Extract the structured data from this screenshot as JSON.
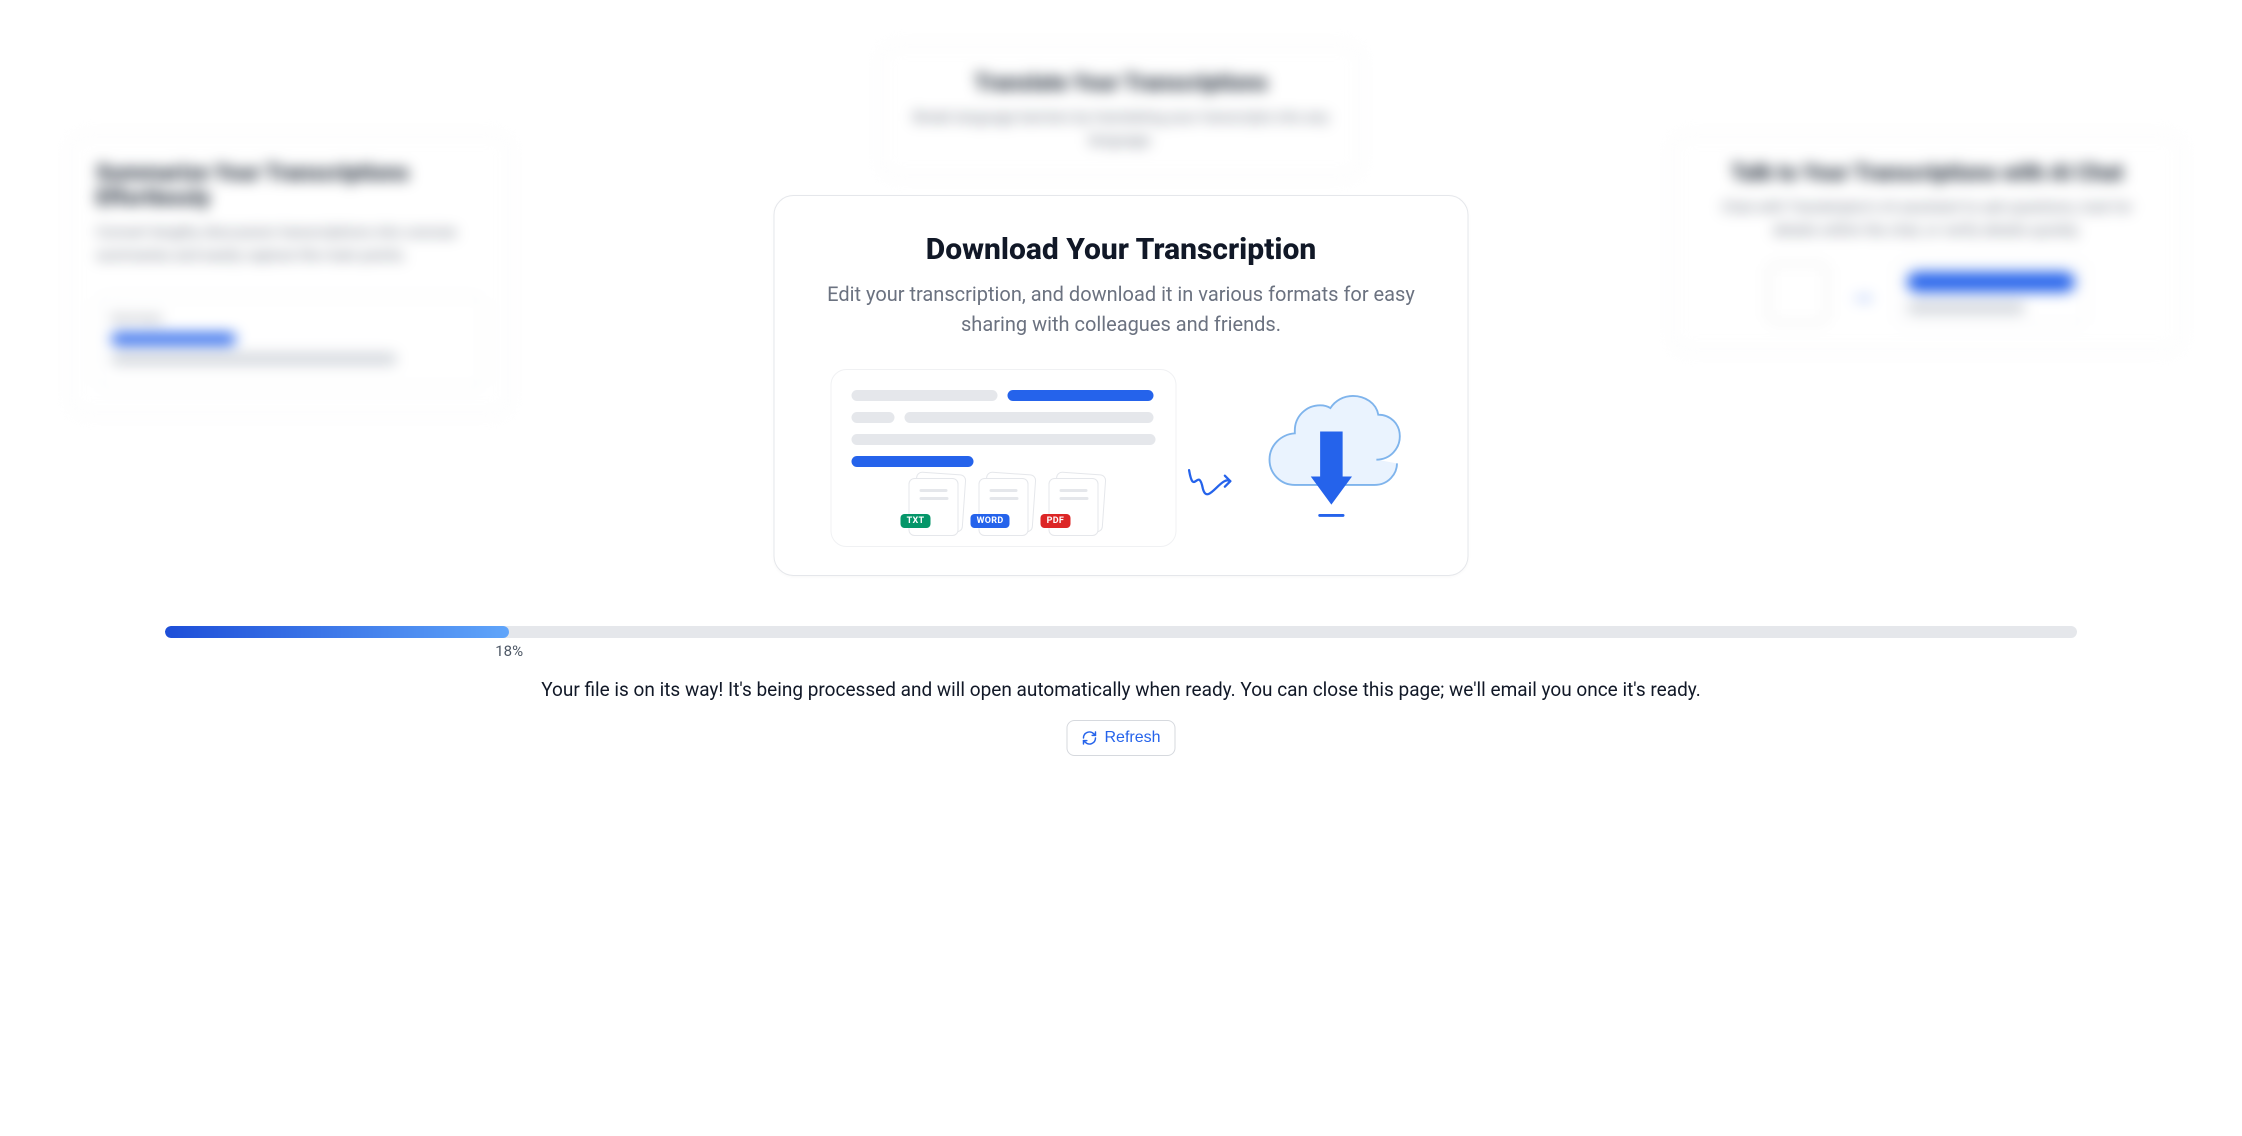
{
  "background": {
    "left": {
      "title": "Summarize Your Transcriptions Effortlessly",
      "desc": "Convert lengthy discussion transcriptions into concise summaries and easily capture the main points."
    },
    "center": {
      "title": "Translate Your Transcriptions",
      "desc": "Break language barriers by translating your transcripts into any language."
    },
    "right": {
      "title": "Talk to Your Transcriptions with AI Chat",
      "desc": "Chat with Transkriptor's AI assistant to ask questions, look for details within the chat, or verify details quickly."
    }
  },
  "modal": {
    "title": "Download Your Transcription",
    "subtitle": "Edit your transcription, and download it in various formats for easy sharing with colleagues and friends.",
    "formats": {
      "txt": "TXT",
      "word": "WORD",
      "pdf": "PDF"
    }
  },
  "progress": {
    "percent": 18,
    "label": "18%"
  },
  "status_message": "Your file is on its way! It's being processed and will open automatically when ready. You can close this page; we'll email you once it's ready.",
  "refresh_label": "Refresh",
  "colors": {
    "primary": "#2563eb",
    "txt_badge": "#059669",
    "pdf_badge": "#dc2626"
  }
}
